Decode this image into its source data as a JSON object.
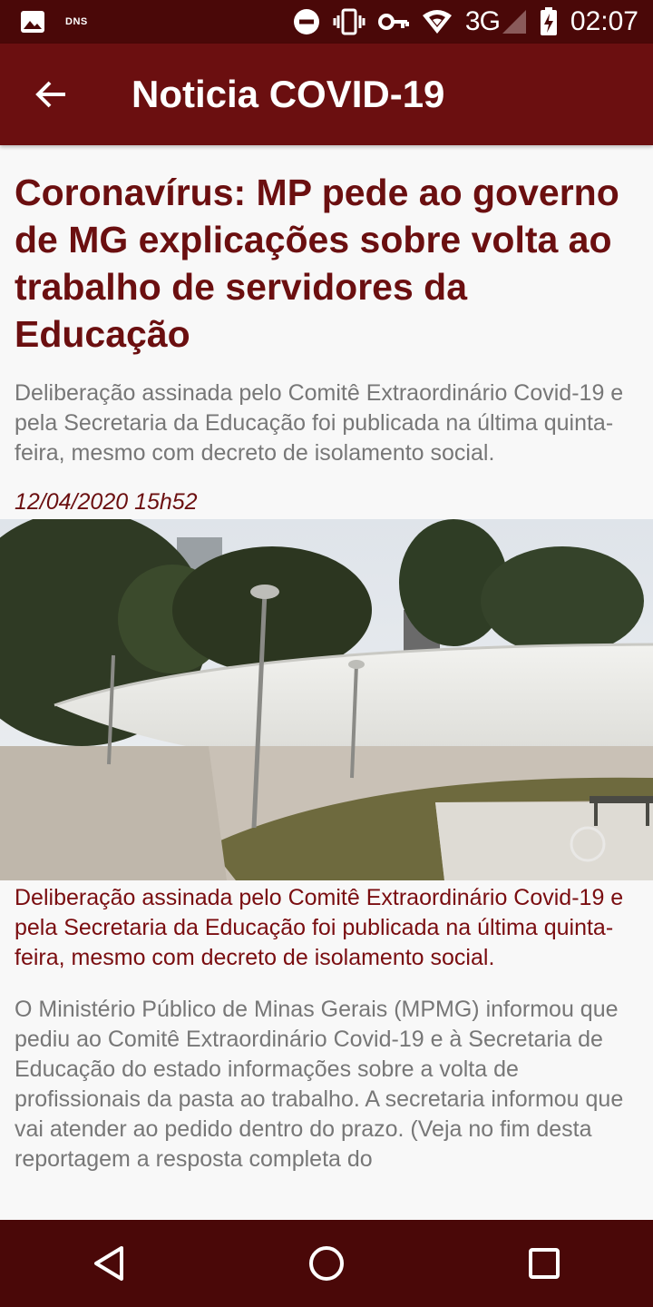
{
  "status_bar": {
    "dns_label": "DNS",
    "network": "3G",
    "time": "02:07",
    "icons": [
      "image-icon",
      "do-not-disturb-icon",
      "vibrate-icon",
      "vpn-key-icon",
      "wifi-icon",
      "signal-icon",
      "battery-charging-icon"
    ]
  },
  "app_bar": {
    "title": "Noticia COVID-19",
    "back_icon": "arrow-back-icon"
  },
  "article": {
    "headline": "Coronavírus: MP pede ao governo de MG explicações sobre volta ao trabalho de servidores da Educação",
    "summary": "Deliberação assinada pelo Comitê Extraordinário Covid-19 e pela Secretaria da Educação foi publicada na última quinta-feira, mesmo com decreto de isolamento social.",
    "date": "12/04/2020 15h52",
    "caption": "Deliberação assinada pelo Comitê Extraordinário Covid-19 e pela Secretaria da Educação foi publicada na última quinta-feira, mesmo com decreto de isolamento social.",
    "body": "O Ministério Público de Minas Gerais (MPMG) informou que pediu ao Comitê Extraordinário Covid-19 e à Secretaria de Educação do estado informações sobre a volta de profissionais da pasta ao trabalho. A secretaria informou que vai atender ao pedido dentro do prazo. (Veja no fim desta reportagem a resposta completa do"
  },
  "nav_bar": {
    "buttons": [
      "back-triangle-icon",
      "home-circle-icon",
      "recents-square-icon"
    ]
  },
  "colors": {
    "status_bar": "#4a0808",
    "app_bar": "#6b0f10",
    "accent_text": "#6b0f10",
    "muted_text": "#777777",
    "background": "#f8f8f8"
  }
}
